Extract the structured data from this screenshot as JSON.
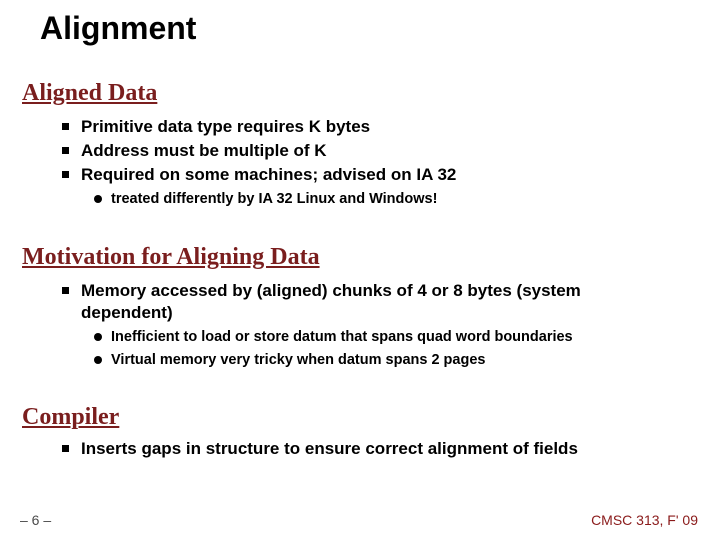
{
  "title": "Alignment",
  "sections": [
    {
      "heading": "Aligned Data",
      "bullets": [
        {
          "text": "Primitive data type requires K bytes",
          "sub": []
        },
        {
          "text": "Address must be multiple of K",
          "sub": []
        },
        {
          "text": "Required on some machines; advised on IA 32",
          "sub": [
            "treated differently by IA 32 Linux and Windows!"
          ]
        }
      ]
    },
    {
      "heading": "Motivation for Aligning Data",
      "bullets": [
        {
          "text": "Memory accessed by (aligned) chunks of 4 or 8 bytes (system dependent)",
          "sub": [
            "Inefficient to load or store datum that spans quad word boundaries",
            "Virtual memory very tricky when datum spans 2 pages"
          ]
        }
      ]
    },
    {
      "heading": "Compiler",
      "bullets": [
        {
          "text": "Inserts gaps in structure to ensure correct alignment of fields",
          "sub": []
        }
      ]
    }
  ],
  "page": "– 6 –",
  "course": "CMSC 313, F' 09"
}
